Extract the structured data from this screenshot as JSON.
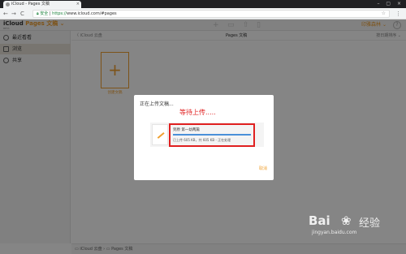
{
  "browser": {
    "tab_title": "iCloud - Pages 文稿",
    "tab_close": "×",
    "window_controls": "– ▢ ×",
    "back": "←",
    "forward": "→",
    "reload": "C",
    "secure_label": "安全",
    "url_protocol": "https://",
    "url_rest": "www.icloud.com/#pages",
    "star": "☆",
    "menu": "⋮"
  },
  "app": {
    "brand_icloud": "iCloud",
    "brand_pages": "Pages 文稿",
    "brand_chevron": "⌄",
    "brand_sub": "BETA",
    "user_name": "印雅森林",
    "user_chevron": "⌄",
    "help": "?",
    "toolbar_icons": [
      "plus-icon",
      "folder-icon",
      "upload-icon",
      "trash-icon"
    ],
    "toolbar_glyphs": {
      "plus": "+",
      "folder": "▭",
      "upload": "⇧",
      "trash": "▯"
    }
  },
  "sidebar": {
    "items": [
      {
        "label": "最近看看",
        "active": false
      },
      {
        "label": "浏览",
        "active": true
      },
      {
        "label": "共享",
        "active": false
      }
    ]
  },
  "main": {
    "back_label": "〈 iCloud 云盘",
    "title": "Pages 文稿",
    "sort_label": "按日期排序 ⌄",
    "new_doc_plus": "+",
    "new_doc_label": "创建文稿"
  },
  "footer": {
    "path": "▭ iCloud 云盘  ›  ▭ Pages 文稿"
  },
  "modal": {
    "title": "正在上传文稿...",
    "annotation": "等待上传.....",
    "file_name": "到原 第一幼两篇",
    "status": "已上传 605 KB，共 605 KB - 正在处理",
    "progress": 1.0,
    "cancel_label": "取消"
  },
  "watermark": {
    "brand": "Bai",
    "paw": "❀",
    "jingyan": "经验",
    "url": "jingyan.baidu.com"
  },
  "colors": {
    "accent": "#f0a030",
    "annotation_red": "#e02020",
    "progress_blue": "#4a90d9"
  }
}
